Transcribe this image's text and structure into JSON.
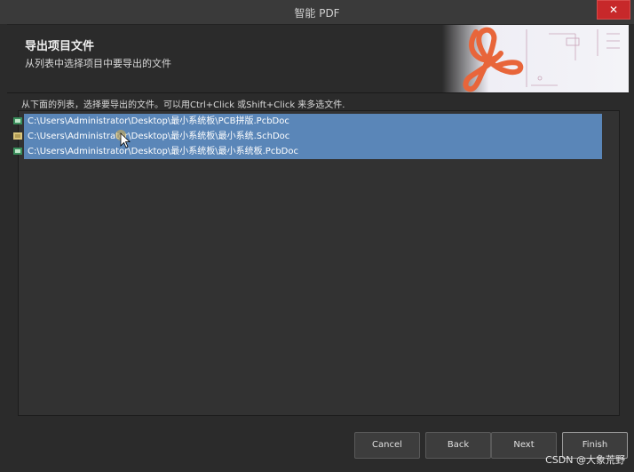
{
  "window": {
    "title": "智能 PDF",
    "close_label": "✕"
  },
  "header": {
    "title": "导出项目文件",
    "subtitle": "从列表中选择项目中要导出的文件"
  },
  "hint": "从下面的列表，选择要导出的文件。可以用Ctrl+Click 或Shift+Click 来多选文件.",
  "files": [
    {
      "path": "C:\\Users\\Administrator\\Desktop\\最小系统板\\PCB拼版.PcbDoc",
      "icon": "pcb-doc-icon"
    },
    {
      "path": "C:\\Users\\Administrator\\Desktop\\最小系统板\\最小系统.SchDoc",
      "icon": "sch-doc-icon"
    },
    {
      "path": "C:\\Users\\Administrator\\Desktop\\最小系统板\\最小系统板.PcbDoc",
      "icon": "pcb-doc-icon"
    }
  ],
  "buttons": {
    "cancel": "Cancel",
    "back": "Back",
    "next": "Next",
    "finish": "Finish"
  },
  "watermark": "CSDN @大象荒野",
  "colors": {
    "selection": "#5a86b8",
    "close": "#c7282a",
    "accent": "#e8653a"
  }
}
